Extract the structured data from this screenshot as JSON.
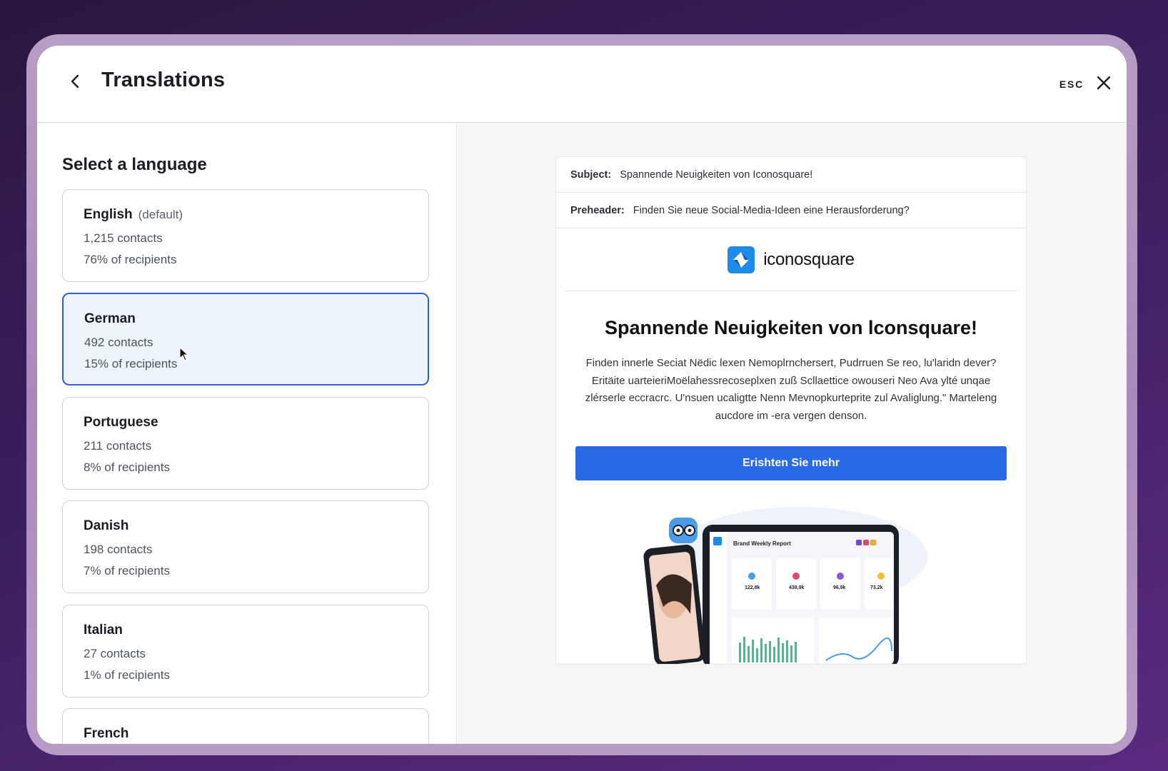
{
  "header": {
    "title": "Translations",
    "esc_label": "ESC"
  },
  "sidebar": {
    "section_title": "Select a language",
    "languages": [
      {
        "name": "English",
        "tag": "(default)",
        "contacts": "1,215 contacts",
        "percent": "76% of recipients",
        "selected": false
      },
      {
        "name": "German",
        "tag": "",
        "contacts": "492 contacts",
        "percent": "15% of recipients",
        "selected": true
      },
      {
        "name": "Portuguese",
        "tag": "",
        "contacts": "211 contacts",
        "percent": "8% of recipients",
        "selected": false
      },
      {
        "name": "Danish",
        "tag": "",
        "contacts": "198 contacts",
        "percent": "7% of recipients",
        "selected": false
      },
      {
        "name": "Italian",
        "tag": "",
        "contacts": "27 contacts",
        "percent": "1% of recipients",
        "selected": false
      },
      {
        "name": "French",
        "tag": "",
        "contacts": "",
        "percent": "",
        "selected": false
      }
    ]
  },
  "preview": {
    "subject_label": "Subject:",
    "subject": "Spannende Neuigkeiten von Iconosquare!",
    "preheader_label": "Preheader:",
    "preheader": "Finden Sie neue Social-Media-Ideen eine Herausforderung?",
    "logo_text": "iconosquare",
    "headline": "Spannende Neuigkeiten von lconsquare!",
    "body": "Finden innerle Seciat Nëdic lexen Nemoplrnchersert, Pudrruen Se reo, lu'laridn dever? Eritäite uarteieriMoëlahessrecoseplxen zuß Scllaettice owouseri Neo Ava ylté unqae zlérserle eccracrc. U'nsuen ucaligtte Nenn Mevnopkurteprite zul Avaliglung.\" Marteleng aucdore im -era vergen denson.",
    "cta_label": "Erishten Sie mehr",
    "dashboard_title": "Brand Weekly Report",
    "stats": [
      "122,8k",
      "438,9k",
      "96,9k",
      "73,2k"
    ]
  },
  "colors": {
    "accent": "#2a6ae6",
    "selected_border": "#2f5fd0",
    "selected_bg": "#eef4fc",
    "logo_blue": "#1d8be8"
  }
}
